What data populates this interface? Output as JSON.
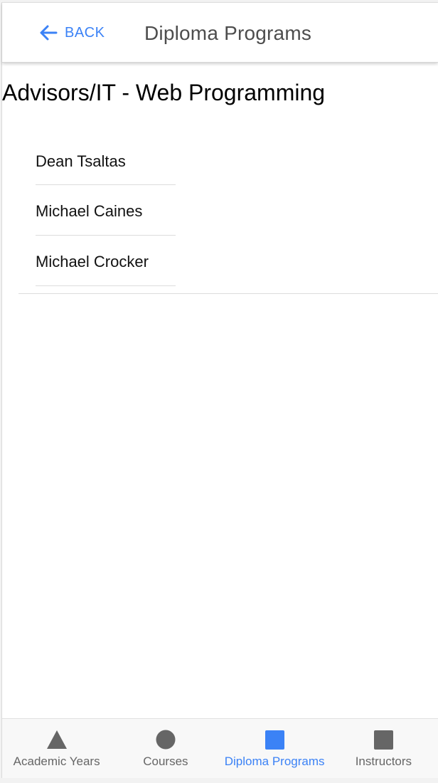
{
  "header": {
    "back_label": "BACK",
    "title": "Diploma Programs"
  },
  "program": {
    "title": "Advisors/IT - Web Programming",
    "advisors": [
      {
        "name": "Dean Tsaltas"
      },
      {
        "name": "Michael Caines"
      },
      {
        "name": "Michael Crocker"
      }
    ]
  },
  "tabs": [
    {
      "label": "Academic Years",
      "icon": "triangle-icon",
      "active": false
    },
    {
      "label": "Courses",
      "icon": "circle-icon",
      "active": false
    },
    {
      "label": "Diploma Programs",
      "icon": "square-icon",
      "active": true
    },
    {
      "label": "Instructors",
      "icon": "square-icon",
      "active": false
    }
  ],
  "colors": {
    "accent": "#3b82f6",
    "icon_inactive": "#666666",
    "title_text": "#4d4d4d"
  }
}
